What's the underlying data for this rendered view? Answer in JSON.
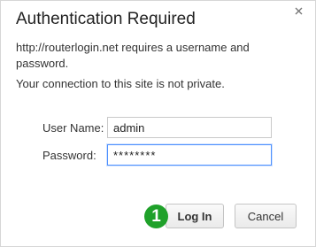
{
  "dialog": {
    "title": "Authentication Required",
    "close_icon": "close-icon",
    "message_line1": "http://routerlogin.net requires a username and password.",
    "message_line2": "Your connection to this site is not private."
  },
  "form": {
    "username_label": "User Name:",
    "username_value": "admin",
    "password_label": "Password:",
    "password_value": "********"
  },
  "buttons": {
    "login_label": "Log In",
    "cancel_label": "Cancel"
  },
  "annotation": {
    "step_number": "1",
    "color": "#1fa12a"
  }
}
